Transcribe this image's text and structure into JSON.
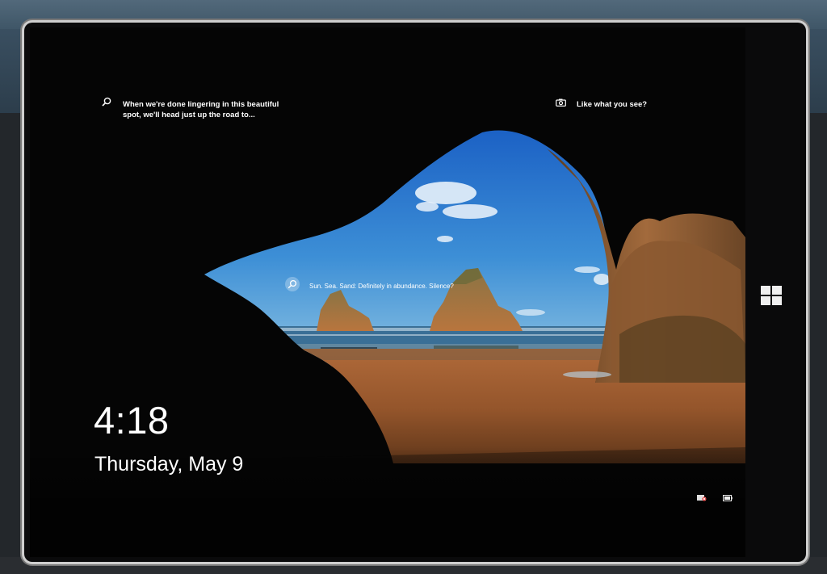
{
  "lock_screen": {
    "hint_top_left": "When we're done lingering in this beautiful spot, we'll head just up the road to...",
    "hint_top_right": "Like what you see?",
    "hint_center": "Sun. Sea. Sand: Definitely in abundance. Silence?",
    "time": "4:18",
    "date": "Thursday, May 9"
  },
  "icons": {
    "top_left": "search-icon",
    "top_right": "camera-icon",
    "center": "search-icon",
    "status_left": "network-icon",
    "status_right": "battery-icon",
    "hardware": "windows-logo-icon"
  },
  "colors": {
    "sky": "#2f7fd0",
    "sand": "#9a5a2e",
    "rock": "#6b4a2c",
    "text": "#ffffff"
  }
}
